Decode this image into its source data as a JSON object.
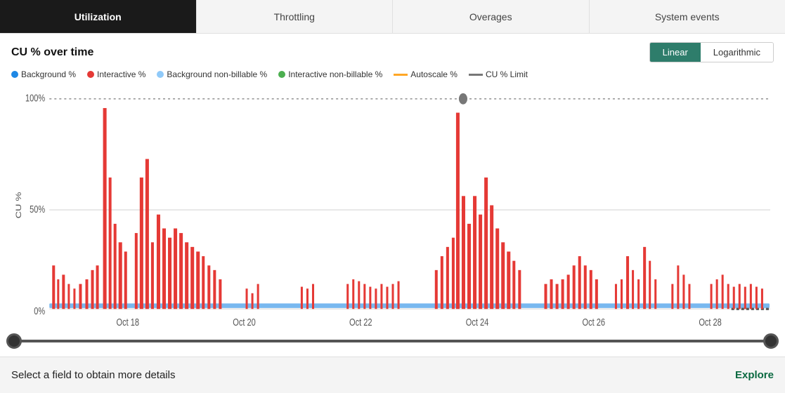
{
  "tabs": [
    {
      "label": "Utilization",
      "active": true
    },
    {
      "label": "Throttling",
      "active": false
    },
    {
      "label": "Overages",
      "active": false
    },
    {
      "label": "System events",
      "active": false
    }
  ],
  "header": {
    "title": "CU % over time",
    "scale_linear": "Linear",
    "scale_logarithmic": "Logarithmic"
  },
  "legend": [
    {
      "label": "Background %",
      "color": "#1e88e5",
      "type": "dot"
    },
    {
      "label": "Interactive %",
      "color": "#e53935",
      "type": "dot"
    },
    {
      "label": "Background non-billable %",
      "color": "#90caf9",
      "type": "dot"
    },
    {
      "label": "Interactive non-billable %",
      "color": "#4caf50",
      "type": "dot"
    },
    {
      "label": "Autoscale %",
      "color": "#ffa726",
      "type": "dash"
    },
    {
      "label": "CU % Limit",
      "color": "#777",
      "type": "dash"
    }
  ],
  "chart": {
    "y_labels": [
      "100%",
      "50%",
      "0%"
    ],
    "x_labels": [
      "Oct 18",
      "Oct 20",
      "Oct 22",
      "Oct 24",
      "Oct 26",
      "Oct 28"
    ],
    "y_axis_label": "CU %"
  },
  "footer": {
    "select_text": "Select a field to obtain more details",
    "explore_label": "Explore"
  }
}
